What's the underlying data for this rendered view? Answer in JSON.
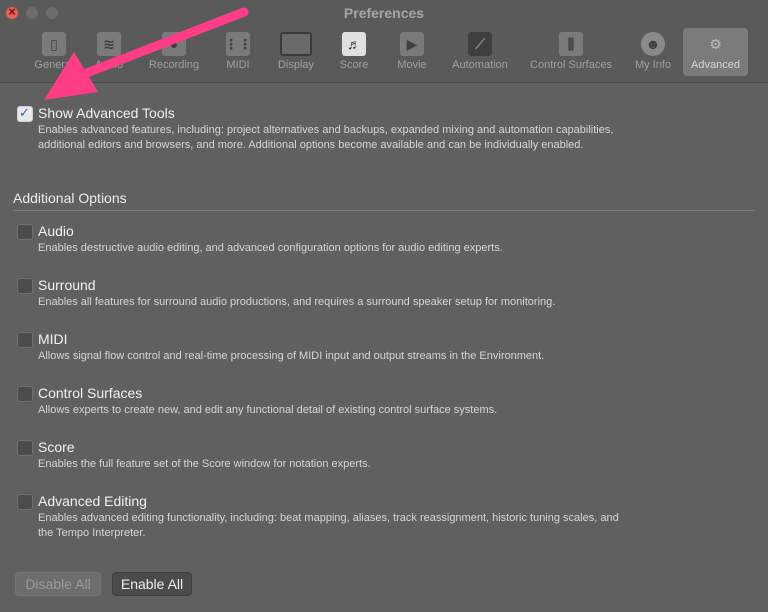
{
  "window": {
    "title": "Preferences"
  },
  "toolbar": {
    "items": [
      {
        "label": "General",
        "icon": "general-icon"
      },
      {
        "label": "Audio",
        "icon": "audio-icon"
      },
      {
        "label": "Recording",
        "icon": "recording-icon"
      },
      {
        "label": "MIDI",
        "icon": "midi-icon"
      },
      {
        "label": "Display",
        "icon": "display-icon"
      },
      {
        "label": "Score",
        "icon": "score-icon"
      },
      {
        "label": "Movie",
        "icon": "movie-icon"
      },
      {
        "label": "Automation",
        "icon": "automation-icon"
      },
      {
        "label": "Control Surfaces",
        "icon": "control-surfaces-icon"
      },
      {
        "label": "My Info",
        "icon": "my-info-icon"
      },
      {
        "label": "Advanced",
        "icon": "gear-icon",
        "active": true
      }
    ]
  },
  "advanced": {
    "show_tools_label": "Show Advanced Tools",
    "show_tools_checked": true,
    "show_tools_desc_line1": "Enables advanced features, including: project alternatives and backups, expanded mixing and automation capabilities,",
    "show_tools_desc_line2": "additional editors and browsers, and more. Additional options become available and can be individually enabled.",
    "section_title": "Additional Options",
    "options": [
      {
        "label": "Audio",
        "checked": false,
        "desc": "Enables destructive audio editing, and advanced configuration options for audio editing experts."
      },
      {
        "label": "Surround",
        "checked": false,
        "desc": "Enables all features for surround audio productions, and requires a surround speaker setup for monitoring."
      },
      {
        "label": "MIDI",
        "checked": false,
        "desc": "Allows signal flow control and real-time processing of MIDI input and output streams in the Environment."
      },
      {
        "label": "Control Surfaces",
        "checked": false,
        "desc": "Allows experts to create new, and edit any functional detail of existing control surface systems."
      },
      {
        "label": "Score",
        "checked": false,
        "desc": "Enables the full feature set of the Score window for notation experts."
      },
      {
        "label": "Advanced Editing",
        "checked": false,
        "desc_line1": "Enables advanced editing functionality, including: beat mapping, aliases, track reassignment, historic tuning scales, and",
        "desc_line2": "the Tempo Interpreter."
      }
    ],
    "disable_all_label": "Disable All",
    "enable_all_label": "Enable All"
  },
  "colors": {
    "annotation_arrow": "#ff3d86",
    "checkbox_accent": "#2a63c8"
  }
}
